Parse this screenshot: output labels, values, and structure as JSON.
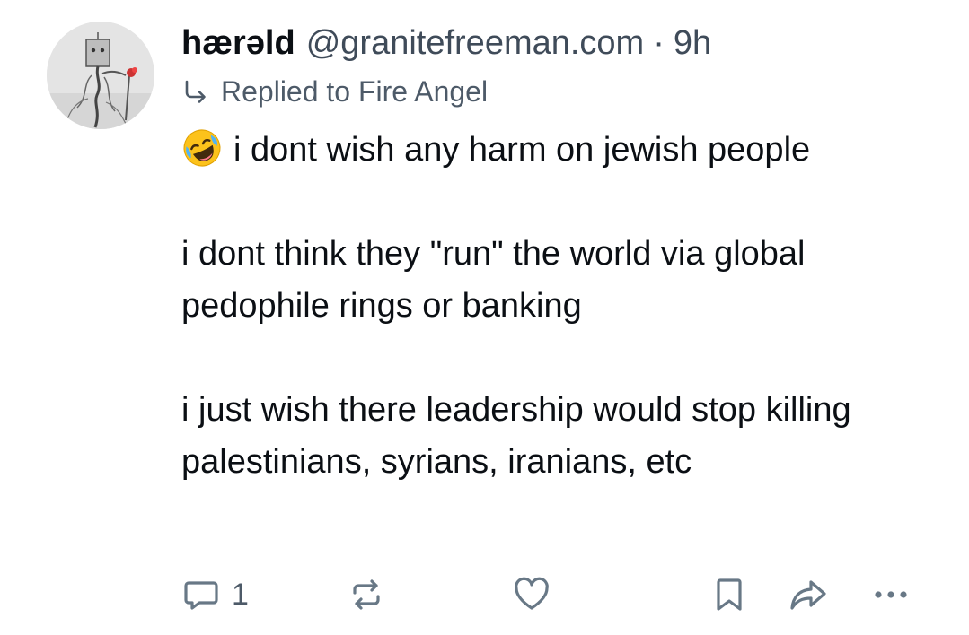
{
  "post": {
    "author": {
      "display_name": "hærəld",
      "handle": "@granitefreeman.com",
      "separator": "·",
      "time": "9h"
    },
    "reply": {
      "icon": "reply-arrow-icon",
      "label": "Replied to Fire Angel"
    },
    "body": {
      "emoji": "rolling-on-floor-laughing-emoji",
      "paragraph_1": "i dont wish any harm on jewish people",
      "paragraph_2": "i dont think they \"run\" the world via global pedophile rings or banking",
      "paragraph_3": "i just wish there leadership would stop killing palestinians, syrians, iranians, etc"
    },
    "actions": {
      "reply_count": "1",
      "icons": [
        "comment-icon",
        "repost-icon",
        "like-heart-icon",
        "bookmark-icon",
        "share-icon",
        "more-options-icon"
      ]
    }
  },
  "colors": {
    "text": "#0b0f14",
    "muted": "#3f4b59",
    "icon": "#687886",
    "emoji_face": "#fcc21b"
  }
}
